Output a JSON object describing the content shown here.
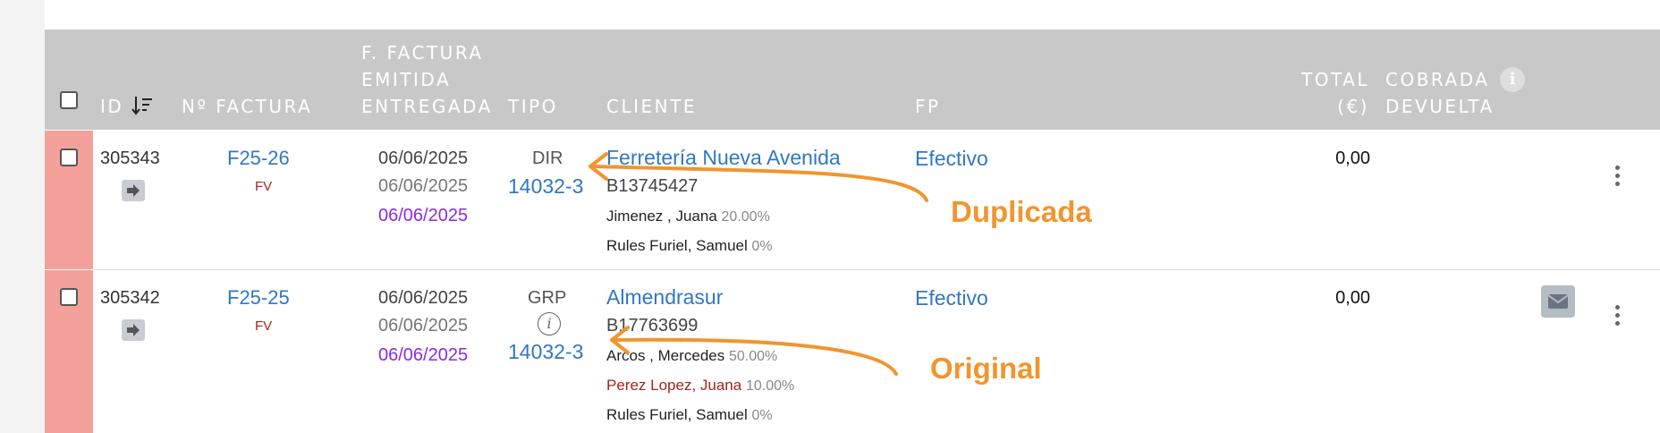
{
  "header": {
    "id": "ID",
    "num_factura": "Nº FACTURA",
    "fecha_line1": "F. FACTURA",
    "fecha_line2": "EMITIDA",
    "fecha_line3": "ENTREGADA",
    "tipo": "TIPO",
    "cliente": "CLIENTE",
    "fp": "FP",
    "total_line1": "TOTAL",
    "total_line2": "(€)",
    "cobrada_line1": "COBRADA",
    "cobrada_line2": "DEVUELTA"
  },
  "rows": [
    {
      "id": "305343",
      "factura": "F25-26",
      "serie": "FV",
      "fecha_factura": "06/06/2025",
      "fecha_emitida": "06/06/2025",
      "fecha_entregada": "06/06/2025",
      "tipo": "DIR",
      "tipo_ref": "14032-3",
      "cliente": "Ferretería Nueva Avenida",
      "cif": "B13745427",
      "agents": [
        {
          "name": "Jimenez , Juana",
          "pct": "20.00%"
        },
        {
          "name": "Rules Furiel, Samuel",
          "pct": "0%"
        }
      ],
      "fp": "Efectivo",
      "total": "0,00"
    },
    {
      "id": "305342",
      "factura": "F25-25",
      "serie": "FV",
      "fecha_factura": "06/06/2025",
      "fecha_emitida": "06/06/2025",
      "fecha_entregada": "06/06/2025",
      "tipo": "GRP",
      "tipo_ref": "14032-3",
      "cliente": "Almendrasur",
      "cif": "B17763699",
      "agents": [
        {
          "name": "Arcos , Mercedes",
          "pct": "50.00%"
        },
        {
          "name": "Perez Lopez, Juana",
          "pct": "10.00%"
        },
        {
          "name": "Rules Furiel, Samuel",
          "pct": "0%"
        }
      ],
      "fp": "Efectivo",
      "total": "0,00"
    }
  ],
  "annotations": {
    "duplicada": "Duplicada",
    "original": "Original"
  },
  "colors": {
    "header_bg": "#c8c8c8",
    "row_marker": "#f4a19b",
    "link": "#2f78c4",
    "annotation": "#f0952f",
    "date_entregada": "#8a2be2",
    "serie": "#a1251b"
  }
}
